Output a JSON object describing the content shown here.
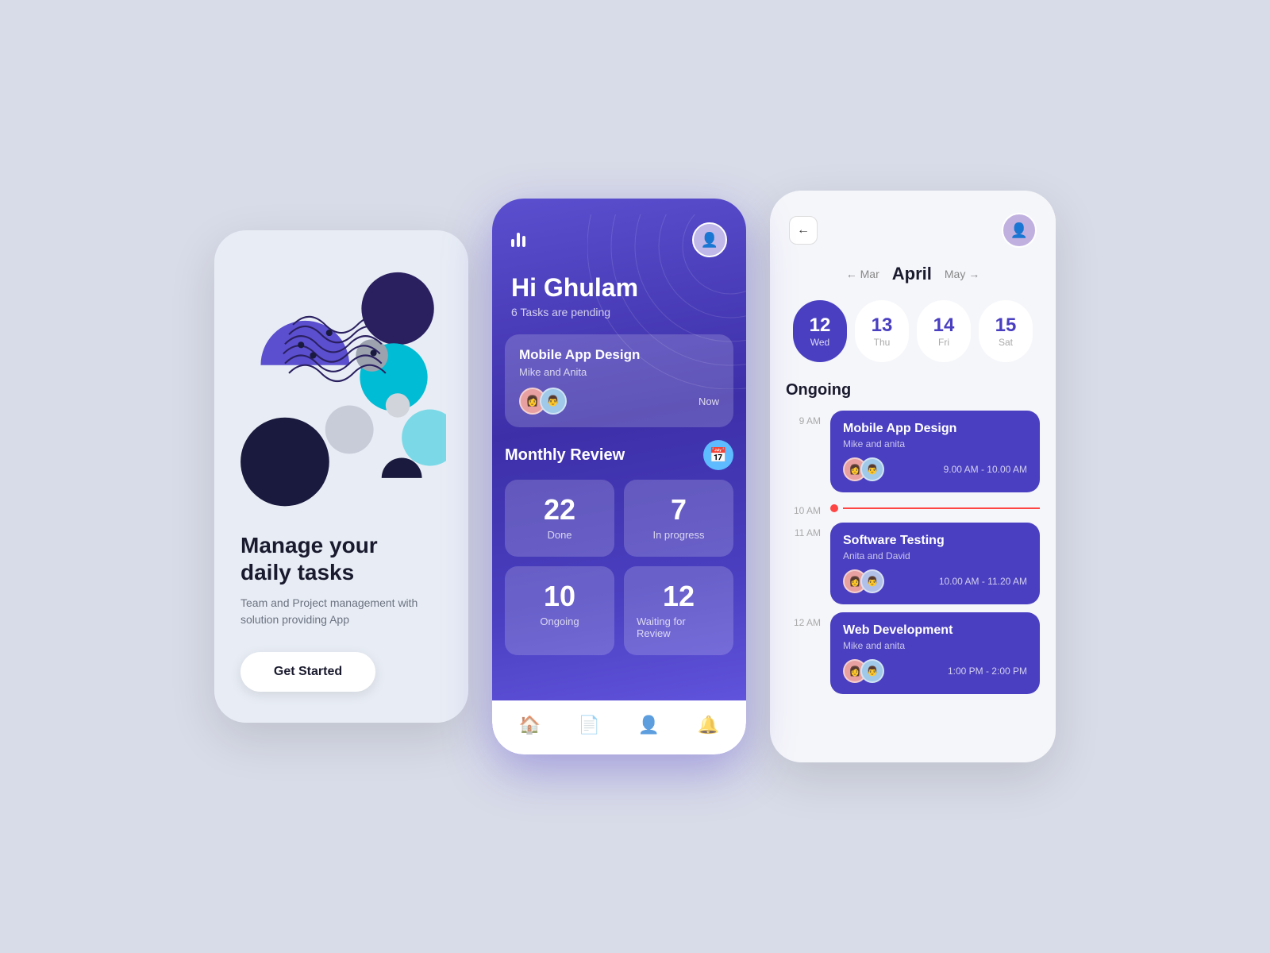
{
  "screen1": {
    "title": "Manage your\ndaily tasks",
    "subtitle": "Team and Project management with solution providing App",
    "cta": "Get Started"
  },
  "screen2": {
    "greeting": "Hi Ghulam",
    "pending": "6 Tasks are pending",
    "task": {
      "title": "Mobile App Design",
      "members": "Mike and Anita",
      "badge": "Now"
    },
    "review": {
      "title": "Monthly Review",
      "stats": [
        {
          "number": "22",
          "label": "Done"
        },
        {
          "number": "7",
          "label": "In progress"
        },
        {
          "number": "10",
          "label": "Ongoing"
        },
        {
          "number": "12",
          "label": "Waiting for Review"
        }
      ]
    },
    "nav": [
      "🏠",
      "📄",
      "👤",
      "🔔"
    ]
  },
  "screen3": {
    "month": "April",
    "prev_month": "Mar",
    "next_month": "May",
    "dates": [
      {
        "num": "12",
        "day": "Wed",
        "active": true
      },
      {
        "num": "13",
        "day": "Thu",
        "active": false
      },
      {
        "num": "14",
        "day": "Fri",
        "active": false
      },
      {
        "num": "15",
        "day": "Sat",
        "active": false
      }
    ],
    "ongoing_label": "Ongoing",
    "schedule": [
      {
        "time": "9 AM",
        "title": "Mobile App Design",
        "members": "Mike and anita",
        "timeRange": "9.00 AM - 10.00 AM"
      },
      {
        "time": "10 AM",
        "current": true
      },
      {
        "time": "11 AM",
        "title": "Software Testing",
        "members": "Anita and David",
        "timeRange": "10.00 AM - 11.20 AM"
      },
      {
        "time": "12 AM",
        "title": "Web Development",
        "members": "Mike and anita",
        "timeRange": "1:00 PM - 2:00 PM"
      }
    ]
  }
}
